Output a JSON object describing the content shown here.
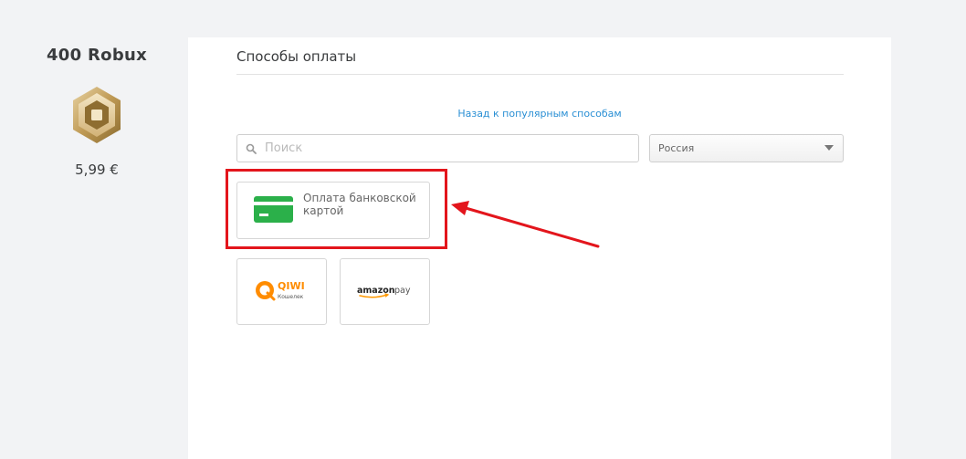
{
  "product": {
    "title": "400 Robux",
    "price": "5,99 €",
    "icon": "robux-icon"
  },
  "panel": {
    "title": "Способы оплаты",
    "back_link": "Назад к популярным способам",
    "search": {
      "placeholder": "Поиск",
      "value": "",
      "icon": "search-icon"
    },
    "country_select": {
      "selected": "Россия",
      "icon": "chevron-down-icon"
    }
  },
  "payment_methods": {
    "card": {
      "label": "Оплата банковской картой",
      "icon": "credit-card-icon"
    },
    "qiwi": {
      "brand": "QIWI",
      "sub": "Кошелек",
      "icon": "qiwi-logo"
    },
    "amazon": {
      "brand": "amazon",
      "suffix": "pay",
      "icon": "amazon-pay-logo"
    }
  },
  "annotation": {
    "highlight_color": "#e3151c",
    "arrow_color": "#e3151c"
  },
  "colors": {
    "link": "#2a8fd4",
    "card_green": "#2bb04a",
    "qiwi_orange": "#ff8c00",
    "robux_gold": "#c9a86a"
  }
}
